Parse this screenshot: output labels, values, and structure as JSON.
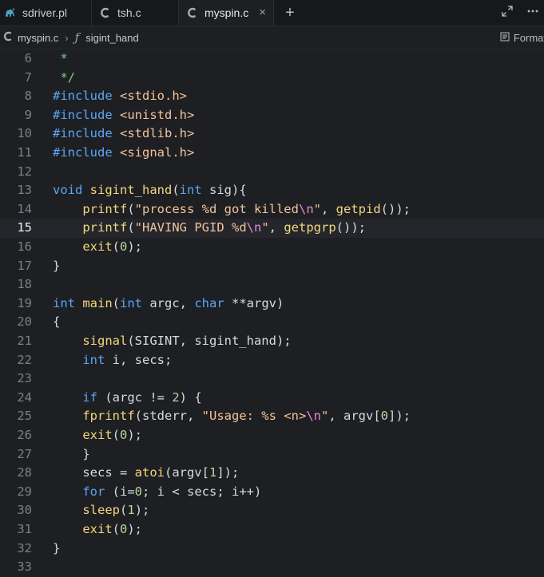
{
  "tabs": [
    {
      "label": "sdriver.pl",
      "icon": "perl-camel-icon"
    },
    {
      "label": "tsh.c",
      "icon": "c-file-icon"
    },
    {
      "label": "myspin.c",
      "icon": "c-file-icon",
      "active": true
    }
  ],
  "tab_close_glyph": "×",
  "new_tab_glyph": "+",
  "breadcrumb": {
    "file": "myspin.c",
    "separator": "›",
    "function_glyph": "ƒ",
    "function": "sigint_hand"
  },
  "format_label": "Format",
  "current_line": "15",
  "lines": [
    {
      "n": "6",
      "tokens": [
        {
          "t": "cm",
          "v": " *"
        }
      ]
    },
    {
      "n": "7",
      "tokens": [
        {
          "t": "cm",
          "v": " */"
        }
      ]
    },
    {
      "n": "8",
      "tokens": [
        {
          "t": "pp",
          "v": "#include "
        },
        {
          "t": "inc",
          "v": "<stdio.h>"
        }
      ]
    },
    {
      "n": "9",
      "tokens": [
        {
          "t": "pp",
          "v": "#include "
        },
        {
          "t": "inc",
          "v": "<unistd.h>"
        }
      ]
    },
    {
      "n": "10",
      "tokens": [
        {
          "t": "pp",
          "v": "#include "
        },
        {
          "t": "inc",
          "v": "<stdlib.h>"
        }
      ]
    },
    {
      "n": "11",
      "tokens": [
        {
          "t": "pp",
          "v": "#include "
        },
        {
          "t": "inc",
          "v": "<signal.h>"
        }
      ]
    },
    {
      "n": "12",
      "tokens": []
    },
    {
      "n": "13",
      "tokens": [
        {
          "t": "kw",
          "v": "void "
        },
        {
          "t": "fn",
          "v": "sigint_hand"
        },
        {
          "t": "plain",
          "v": "("
        },
        {
          "t": "kw",
          "v": "int "
        },
        {
          "t": "plain",
          "v": "sig){"
        }
      ]
    },
    {
      "n": "14",
      "tokens": [
        {
          "t": "plain",
          "v": "    "
        },
        {
          "t": "fn",
          "v": "printf"
        },
        {
          "t": "plain",
          "v": "("
        },
        {
          "t": "str",
          "v": "\"process %d got killed"
        },
        {
          "t": "esc",
          "v": "\\n"
        },
        {
          "t": "str",
          "v": "\""
        },
        {
          "t": "plain",
          "v": ", "
        },
        {
          "t": "fn",
          "v": "getpid"
        },
        {
          "t": "plain",
          "v": "());"
        }
      ]
    },
    {
      "n": "15",
      "tokens": [
        {
          "t": "plain",
          "v": "    "
        },
        {
          "t": "fn",
          "v": "printf"
        },
        {
          "t": "plain",
          "v": "("
        },
        {
          "t": "str",
          "v": "\"HAVING PGID %d"
        },
        {
          "t": "esc",
          "v": "\\n"
        },
        {
          "t": "str",
          "v": "\""
        },
        {
          "t": "plain",
          "v": ", "
        },
        {
          "t": "fn",
          "v": "getpgrp"
        },
        {
          "t": "plain",
          "v": "());"
        }
      ]
    },
    {
      "n": "16",
      "tokens": [
        {
          "t": "plain",
          "v": "    "
        },
        {
          "t": "fn",
          "v": "exit"
        },
        {
          "t": "plain",
          "v": "("
        },
        {
          "t": "num",
          "v": "0"
        },
        {
          "t": "plain",
          "v": ");"
        }
      ]
    },
    {
      "n": "17",
      "tokens": [
        {
          "t": "plain",
          "v": "}"
        }
      ]
    },
    {
      "n": "18",
      "tokens": []
    },
    {
      "n": "19",
      "tokens": [
        {
          "t": "kw",
          "v": "int "
        },
        {
          "t": "fn",
          "v": "main"
        },
        {
          "t": "plain",
          "v": "("
        },
        {
          "t": "kw",
          "v": "int "
        },
        {
          "t": "plain",
          "v": "argc, "
        },
        {
          "t": "kw",
          "v": "char "
        },
        {
          "t": "plain",
          "v": "**argv)"
        }
      ]
    },
    {
      "n": "20",
      "tokens": [
        {
          "t": "plain",
          "v": "{"
        }
      ]
    },
    {
      "n": "21",
      "tokens": [
        {
          "t": "plain",
          "v": "    "
        },
        {
          "t": "fn",
          "v": "signal"
        },
        {
          "t": "plain",
          "v": "(SIGINT, sigint_hand);"
        }
      ]
    },
    {
      "n": "22",
      "tokens": [
        {
          "t": "plain",
          "v": "    "
        },
        {
          "t": "kw",
          "v": "int "
        },
        {
          "t": "plain",
          "v": "i, secs;"
        }
      ]
    },
    {
      "n": "23",
      "tokens": []
    },
    {
      "n": "24",
      "tokens": [
        {
          "t": "plain",
          "v": "    "
        },
        {
          "t": "kw",
          "v": "if "
        },
        {
          "t": "plain",
          "v": "(argc != "
        },
        {
          "t": "num",
          "v": "2"
        },
        {
          "t": "plain",
          "v": ") {"
        }
      ]
    },
    {
      "n": "25",
      "tokens": [
        {
          "t": "plain",
          "v": "    "
        },
        {
          "t": "fn",
          "v": "fprintf"
        },
        {
          "t": "plain",
          "v": "(stderr, "
        },
        {
          "t": "str",
          "v": "\"Usage: %s <n>"
        },
        {
          "t": "esc",
          "v": "\\n"
        },
        {
          "t": "str",
          "v": "\""
        },
        {
          "t": "plain",
          "v": ", argv["
        },
        {
          "t": "num",
          "v": "0"
        },
        {
          "t": "plain",
          "v": "]);"
        }
      ]
    },
    {
      "n": "26",
      "tokens": [
        {
          "t": "plain",
          "v": "    "
        },
        {
          "t": "fn",
          "v": "exit"
        },
        {
          "t": "plain",
          "v": "("
        },
        {
          "t": "num",
          "v": "0"
        },
        {
          "t": "plain",
          "v": ");"
        }
      ]
    },
    {
      "n": "27",
      "tokens": [
        {
          "t": "plain",
          "v": "    }"
        }
      ]
    },
    {
      "n": "28",
      "tokens": [
        {
          "t": "plain",
          "v": "    secs = "
        },
        {
          "t": "fn",
          "v": "atoi"
        },
        {
          "t": "plain",
          "v": "(argv["
        },
        {
          "t": "num",
          "v": "1"
        },
        {
          "t": "plain",
          "v": "]);"
        }
      ]
    },
    {
      "n": "29",
      "tokens": [
        {
          "t": "plain",
          "v": "    "
        },
        {
          "t": "kw",
          "v": "for "
        },
        {
          "t": "plain",
          "v": "(i="
        },
        {
          "t": "num",
          "v": "0"
        },
        {
          "t": "plain",
          "v": "; i < secs; i++)"
        }
      ]
    },
    {
      "n": "30",
      "tokens": [
        {
          "t": "plain",
          "v": "    "
        },
        {
          "t": "fn",
          "v": "sleep"
        },
        {
          "t": "plain",
          "v": "("
        },
        {
          "t": "num",
          "v": "1"
        },
        {
          "t": "plain",
          "v": ");"
        }
      ]
    },
    {
      "n": "31",
      "tokens": [
        {
          "t": "plain",
          "v": "    "
        },
        {
          "t": "fn",
          "v": "exit"
        },
        {
          "t": "plain",
          "v": "("
        },
        {
          "t": "num",
          "v": "0"
        },
        {
          "t": "plain",
          "v": ");"
        }
      ]
    },
    {
      "n": "32",
      "tokens": [
        {
          "t": "plain",
          "v": "}"
        }
      ]
    },
    {
      "n": "33",
      "tokens": []
    }
  ]
}
